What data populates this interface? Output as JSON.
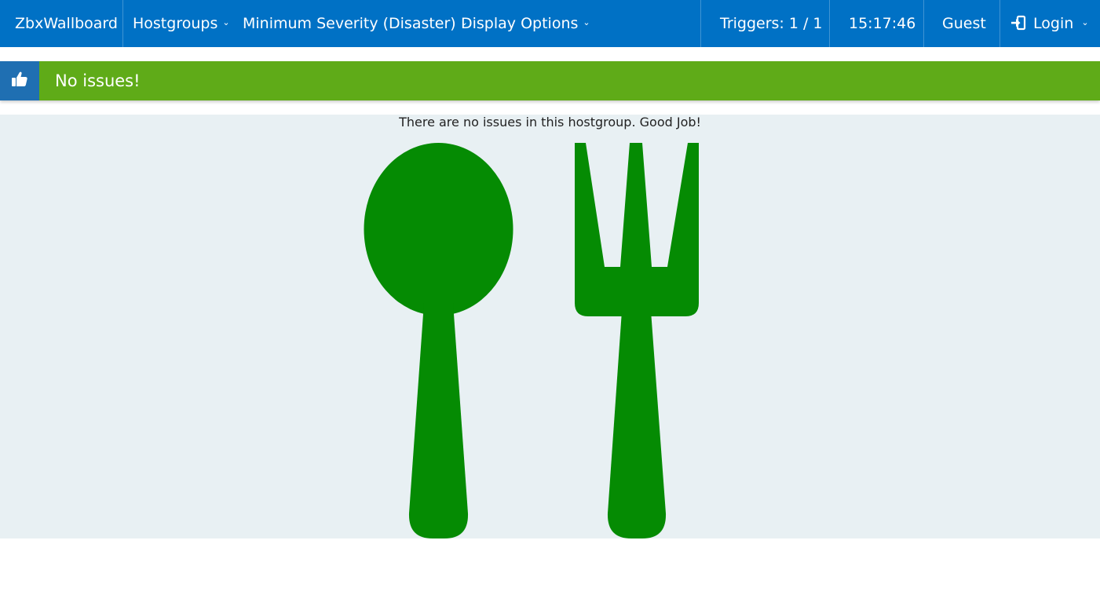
{
  "nav": {
    "brand": "ZbxWallboard",
    "hostgroups": "Hostgroups",
    "severity": "Minimum Severity (Disaster)",
    "display_options": "Display Options",
    "triggers": "Triggers: 1 / 1",
    "clock": "15:17:46",
    "user": "Guest",
    "login": "Login",
    "chevron": "⌄"
  },
  "alert": {
    "text": "No issues!",
    "icon": "thumbs-up-icon",
    "color": "#5fab18",
    "icon_bg": "#1f6fb2"
  },
  "content": {
    "message": "There are no issues in this hostgroup. Good Job!",
    "illustration": "spoon-and-fork",
    "illustration_color": "#058b03"
  },
  "colors": {
    "navbar": "#0071c5",
    "content_bg": "#e8f0f3"
  }
}
